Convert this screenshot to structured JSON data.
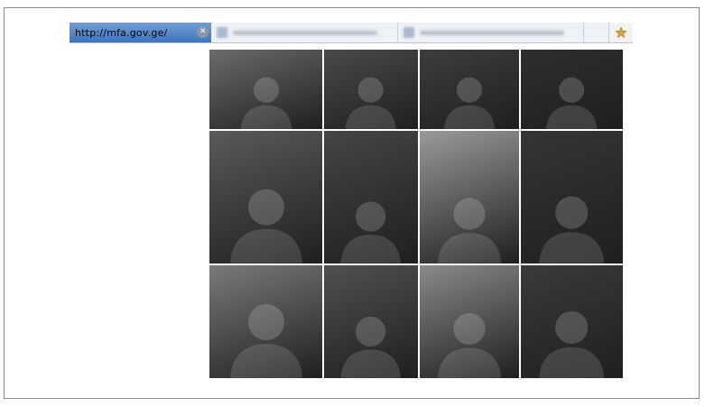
{
  "browser": {
    "active_tab": {
      "label": "http://mfa.gov.ge/"
    },
    "inactive_tabs": [
      {
        "label": ""
      },
      {
        "label": ""
      }
    ],
    "star_icon": "star-icon",
    "close_icon": "close-icon"
  },
  "collage": {
    "rows": 3,
    "columns": 4,
    "photos": [
      {
        "tone": "#6b6b6b"
      },
      {
        "tone": "#4a4a4a"
      },
      {
        "tone": "#3d3d3d"
      },
      {
        "tone": "#2e2e2e"
      },
      {
        "tone": "#5a5a5a"
      },
      {
        "tone": "#454545"
      },
      {
        "tone": "#9a9a9a"
      },
      {
        "tone": "#353535"
      },
      {
        "tone": "#7a7a7a"
      },
      {
        "tone": "#505050"
      },
      {
        "tone": "#8a8a8a"
      },
      {
        "tone": "#3a3a3a"
      }
    ]
  }
}
